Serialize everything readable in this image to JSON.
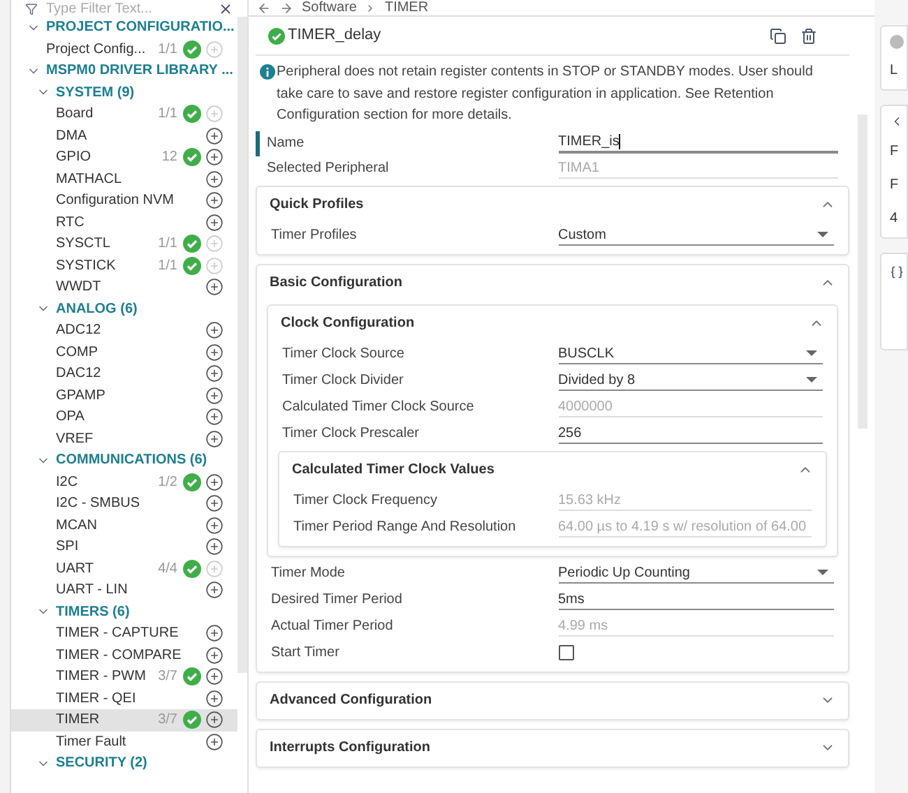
{
  "sidebar": {
    "filter": {
      "placeholder": "Type Filter Text..."
    },
    "tree": [
      {
        "kind": "group",
        "label": "PROJECT CONFIGURATIO...",
        "expanded": true,
        "children": [
          {
            "kind": "module",
            "label": "Project Config...",
            "count": "1/1",
            "configured": true,
            "can_add": false,
            "selected": false
          }
        ]
      },
      {
        "kind": "group",
        "label": "MSPM0 DRIVER LIBRARY ...",
        "expanded": true,
        "children": [
          {
            "kind": "group",
            "label": "SYSTEM (9)",
            "expanded": true,
            "children": [
              {
                "kind": "module",
                "label": "Board",
                "count": "1/1",
                "configured": true,
                "can_add": false,
                "selected": false
              },
              {
                "kind": "module",
                "label": "DMA",
                "configured": false,
                "can_add": true,
                "selected": false
              },
              {
                "kind": "module",
                "label": "GPIO",
                "count": "12",
                "configured": true,
                "can_add": true,
                "selected": false
              },
              {
                "kind": "module",
                "label": "MATHACL",
                "configured": false,
                "can_add": true,
                "selected": false
              },
              {
                "kind": "module",
                "label": "Configuration NVM",
                "configured": false,
                "can_add": true,
                "selected": false
              },
              {
                "kind": "module",
                "label": "RTC",
                "configured": false,
                "can_add": true,
                "selected": false
              },
              {
                "kind": "module",
                "label": "SYSCTL",
                "count": "1/1",
                "configured": true,
                "can_add": false,
                "selected": false
              },
              {
                "kind": "module",
                "label": "SYSTICK",
                "count": "1/1",
                "configured": true,
                "can_add": false,
                "selected": false
              },
              {
                "kind": "module",
                "label": "WWDT",
                "configured": false,
                "can_add": true,
                "selected": false
              }
            ]
          },
          {
            "kind": "group",
            "label": "ANALOG (6)",
            "expanded": true,
            "children": [
              {
                "kind": "module",
                "label": "ADC12",
                "configured": false,
                "can_add": true,
                "selected": false
              },
              {
                "kind": "module",
                "label": "COMP",
                "configured": false,
                "can_add": true,
                "selected": false
              },
              {
                "kind": "module",
                "label": "DAC12",
                "configured": false,
                "can_add": true,
                "selected": false
              },
              {
                "kind": "module",
                "label": "GPAMP",
                "configured": false,
                "can_add": true,
                "selected": false
              },
              {
                "kind": "module",
                "label": "OPA",
                "configured": false,
                "can_add": true,
                "selected": false
              },
              {
                "kind": "module",
                "label": "VREF",
                "configured": false,
                "can_add": true,
                "selected": false
              }
            ]
          },
          {
            "kind": "group",
            "label": "COMMUNICATIONS (6)",
            "expanded": true,
            "children": [
              {
                "kind": "module",
                "label": "I2C",
                "count": "1/2",
                "configured": true,
                "can_add": true,
                "selected": false
              },
              {
                "kind": "module",
                "label": "I2C - SMBUS",
                "configured": false,
                "can_add": true,
                "selected": false
              },
              {
                "kind": "module",
                "label": "MCAN",
                "configured": false,
                "can_add": true,
                "selected": false
              },
              {
                "kind": "module",
                "label": "SPI",
                "configured": false,
                "can_add": true,
                "selected": false
              },
              {
                "kind": "module",
                "label": "UART",
                "count": "4/4",
                "configured": true,
                "can_add": false,
                "selected": false
              },
              {
                "kind": "module",
                "label": "UART - LIN",
                "configured": false,
                "can_add": true,
                "selected": false
              }
            ]
          },
          {
            "kind": "group",
            "label": "TIMERS (6)",
            "expanded": true,
            "children": [
              {
                "kind": "module",
                "label": "TIMER - CAPTURE",
                "configured": false,
                "can_add": true,
                "selected": false
              },
              {
                "kind": "module",
                "label": "TIMER - COMPARE",
                "configured": false,
                "can_add": true,
                "selected": false
              },
              {
                "kind": "module",
                "label": "TIMER - PWM",
                "count": "3/7",
                "configured": true,
                "can_add": true,
                "selected": false
              },
              {
                "kind": "module",
                "label": "TIMER - QEI",
                "configured": false,
                "can_add": true,
                "selected": false
              },
              {
                "kind": "module",
                "label": "TIMER",
                "count": "3/7",
                "configured": true,
                "can_add": true,
                "selected": true
              },
              {
                "kind": "module",
                "label": "Timer Fault",
                "configured": false,
                "can_add": true,
                "selected": false
              }
            ]
          },
          {
            "kind": "group",
            "label": "SECURITY (2)",
            "expanded": true
          }
        ]
      }
    ]
  },
  "breadcrumb": [
    "Software",
    "TIMER"
  ],
  "instance": {
    "name": "TIMER_delay",
    "configured": true
  },
  "notice": "Peripheral does not retain register contents in STOP or STANDBY modes. User should take care to save and restore register configuration in application. See Retention Configuration section for more details.",
  "fields": [
    {
      "kind": "text",
      "label": "Name",
      "value": "TIMER_is",
      "focused": true
    },
    {
      "kind": "readonly",
      "label": "Selected Peripheral",
      "value": "TIMA1"
    }
  ],
  "sections": [
    {
      "kind": "section",
      "title": "Quick Profiles",
      "expanded": true,
      "content": [
        {
          "kind": "select",
          "label": "Timer Profiles",
          "value": "Custom"
        }
      ]
    },
    {
      "kind": "section",
      "title": "Basic Configuration",
      "expanded": true,
      "content": [
        {
          "kind": "section",
          "title": "Clock Configuration",
          "expanded": true,
          "content": [
            {
              "kind": "select",
              "label": "Timer Clock Source",
              "value": "BUSCLK"
            },
            {
              "kind": "select",
              "label": "Timer Clock Divider",
              "value": "Divided by 8"
            },
            {
              "kind": "readonly",
              "label": "Calculated Timer Clock Source",
              "value": "4000000"
            },
            {
              "kind": "text",
              "label": "Timer Clock Prescaler",
              "value": "256"
            },
            {
              "kind": "section",
              "title": "Calculated Timer Clock Values",
              "expanded": true,
              "content": [
                {
                  "kind": "readonly",
                  "label": "Timer Clock Frequency",
                  "value": "15.63 kHz"
                },
                {
                  "kind": "readonly",
                  "label": "Timer Period Range And Resolution",
                  "value": "64.00 µs to 4.19 s w/ resolution of 64.00"
                }
              ]
            }
          ]
        },
        {
          "kind": "select",
          "label": "Timer Mode",
          "value": "Periodic Up Counting"
        },
        {
          "kind": "text",
          "label": "Desired Timer Period",
          "value": "5ms"
        },
        {
          "kind": "readonly",
          "label": "Actual Timer Period",
          "value": "4.99 ms"
        },
        {
          "kind": "checkbox",
          "label": "Start Timer",
          "checked": false
        }
      ]
    },
    {
      "kind": "section",
      "title": "Advanced Configuration",
      "expanded": false
    },
    {
      "kind": "section",
      "title": "Interrupts Configuration",
      "expanded": false
    }
  ],
  "right_panel": {
    "labels": [
      "L",
      "F",
      "F",
      "4"
    ]
  }
}
